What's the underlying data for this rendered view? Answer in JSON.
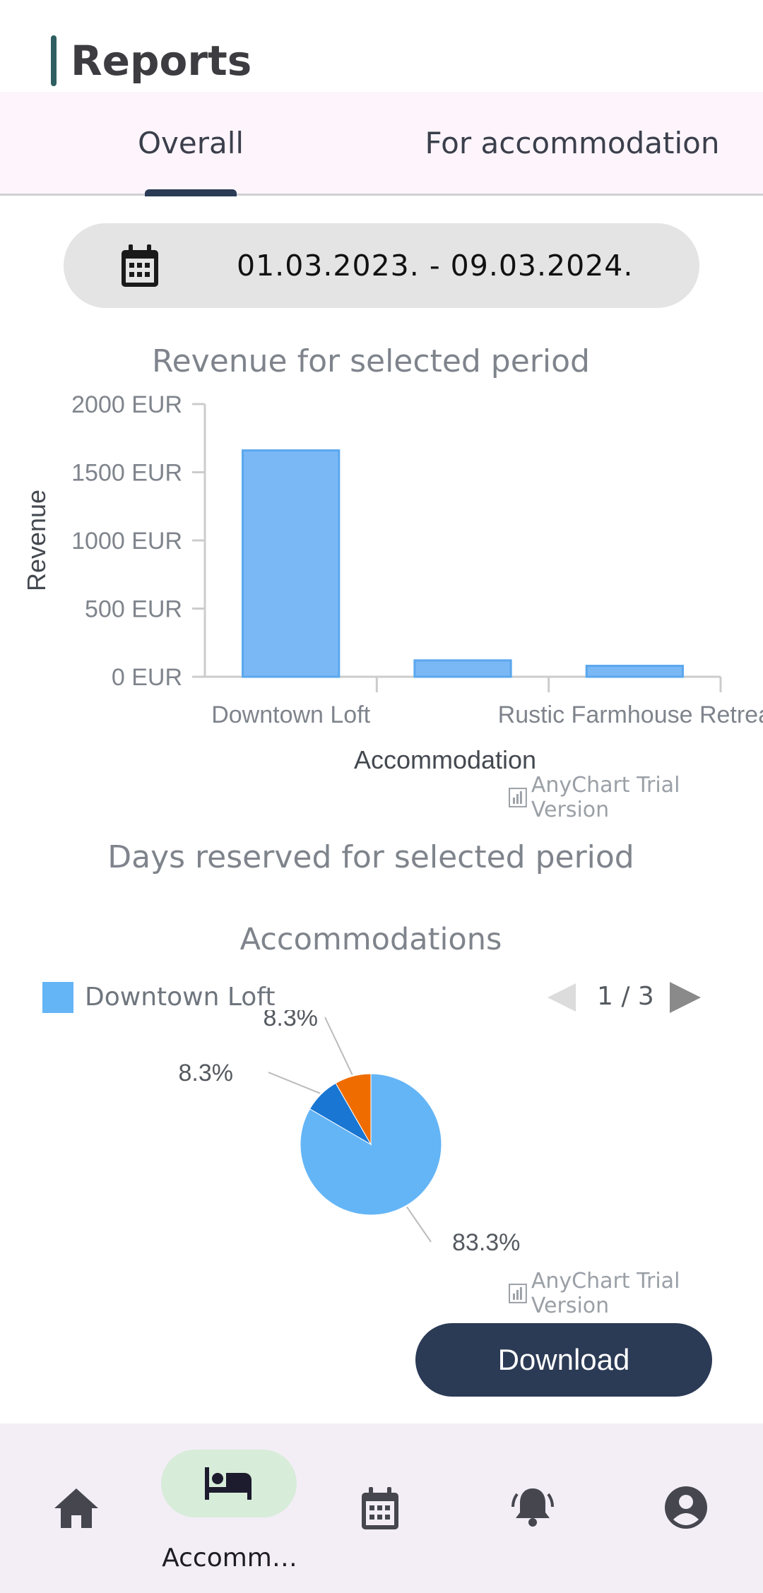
{
  "header": {
    "title": "Reports"
  },
  "tabs": [
    {
      "label": "Overall",
      "selected": true
    },
    {
      "label": "For accommodation",
      "selected": false
    }
  ],
  "date_range": {
    "icon": "calendar-icon",
    "value": "01.03.2023. - 09.03.2024."
  },
  "revenue_chart": {
    "title": "Revenue for selected period",
    "watermark": "AnyChart Trial Version"
  },
  "days_chart": {
    "title": "Days reserved for selected period",
    "subtitle": "Accommodations",
    "legend": {
      "label": "Downtown Loft",
      "color": "#64b5f6"
    },
    "pager": "1 / 3",
    "watermark": "AnyChart Trial Version"
  },
  "chart_data": [
    {
      "type": "bar",
      "title": "Revenue for selected period",
      "xlabel": "Accommodation",
      "ylabel": "Revenue",
      "categories": [
        "Downtown Loft",
        "",
        "Rustic Farmhouse Retrea"
      ],
      "values": [
        1660,
        120,
        80
      ],
      "yticks": [
        "0 EUR",
        "500 EUR",
        "1000 EUR",
        "1500 EUR",
        "2000 EUR"
      ],
      "ylim": [
        0,
        2000
      ],
      "color": "#7ab8f5",
      "grid": false
    },
    {
      "type": "pie",
      "title": "Accommodations",
      "slices": [
        {
          "label": "83.3%",
          "value": 83.3,
          "color": "#64b5f6"
        },
        {
          "label": "8.3%",
          "value": 8.3,
          "color": "#1976d2"
        },
        {
          "label": "8.3%",
          "value": 8.3,
          "color": "#ef6c00"
        }
      ],
      "legend": {
        "position": "top-left",
        "visible_entry": "Downtown Loft",
        "page": "1 / 3"
      }
    }
  ],
  "actions": {
    "download_label": "Download"
  },
  "bottom_nav": [
    {
      "icon": "home-icon",
      "label": ""
    },
    {
      "icon": "bed-icon",
      "label": "Accomm…",
      "active": true
    },
    {
      "icon": "calendar-icon",
      "label": ""
    },
    {
      "icon": "bell-icon",
      "label": ""
    },
    {
      "icon": "account-icon",
      "label": ""
    }
  ]
}
